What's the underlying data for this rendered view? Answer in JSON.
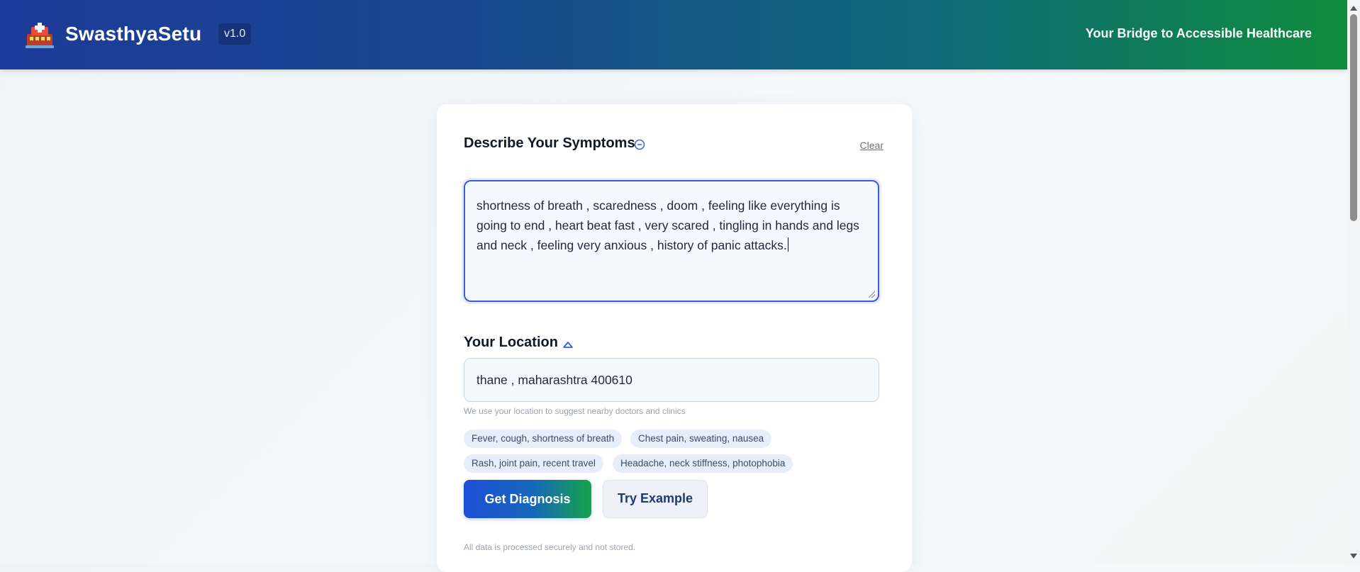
{
  "header": {
    "brand": "SwasthyaSetu",
    "version": "v1.0",
    "tagline": "Your Bridge to Accessible Healthcare",
    "logo_icon": "hospital-logo-icon"
  },
  "symptoms": {
    "title": "Describe Your Symptoms",
    "info_icon": "info-icon",
    "clear_label": "Clear",
    "value": "shortness of breath , scaredness , doom , feeling like everything is going to end , heart beat fast , very scared , tingling in hands and legs and neck , feeling very anxious , history of panic attacks."
  },
  "location": {
    "title": "Your Location",
    "toggle_icon": "chevron-up-icon",
    "value": "thane , maharashtra 400610",
    "helper": "We use your location to suggest nearby doctors and clinics"
  },
  "examples": [
    "Fever, cough, shortness of breath",
    "Chest pain, sweating, nausea",
    "Rash, joint pain, recent travel",
    "Headache, neck stiffness, photophobia"
  ],
  "actions": {
    "primary_label": "Get Diagnosis",
    "secondary_label": "Try Example"
  },
  "footnote": "All data is processed securely and not stored.",
  "colors": {
    "header_start": "#1e3a9a",
    "header_end": "#0f8c3d",
    "accent": "#3b5bdb",
    "chip_bg": "#e6eefb"
  }
}
